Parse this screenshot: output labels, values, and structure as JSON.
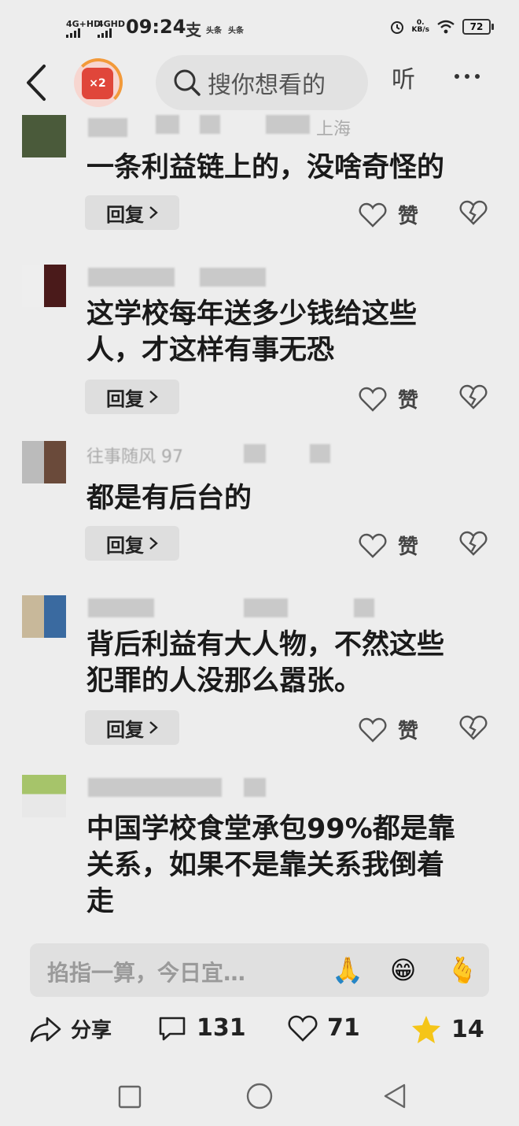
{
  "status_bar": {
    "net1": "4G+HD",
    "net2": "4GHD",
    "time": "09:24",
    "app_icons": [
      "支",
      "头条",
      "头条"
    ],
    "speed_top": "0.",
    "speed_unit": "KB/s",
    "battery": "72"
  },
  "header": {
    "badge_text": "×2",
    "search_placeholder": "搜你想看的",
    "partial_label": "听"
  },
  "comments": [
    {
      "username_partial": "上海",
      "text_lines": [
        "一条利益链上的，没啥奇怪的"
      ],
      "reply_label": "回复",
      "like_label": "赞"
    },
    {
      "username_partial": "",
      "text_lines": [
        "这学校每年送多少钱给这些",
        "人，才这样有事无恐"
      ],
      "reply_label": "回复",
      "like_label": "赞"
    },
    {
      "username_partial": "往事随风 97",
      "text_lines": [
        "都是有后台的"
      ],
      "reply_label": "回复",
      "like_label": "赞"
    },
    {
      "username_partial": "",
      "text_lines": [
        "背后利益有大人物，不然这些",
        "犯罪的人没那么嚣张。"
      ],
      "reply_label": "回复",
      "like_label": "赞"
    },
    {
      "username_partial": "",
      "text_lines": [
        "中国学校食堂承包99%都是靠",
        "关系，如果不是靠关系我倒着",
        "走"
      ],
      "reply_label": "",
      "like_label": ""
    }
  ],
  "input_bar": {
    "placeholder": "掐指一算，今日宜…",
    "emojis": [
      "🙏",
      "😁",
      "🫰"
    ]
  },
  "action_bar": {
    "share_label": "分享",
    "comment_count": "131",
    "like_count": "71",
    "fav_count": "14"
  },
  "colors": {
    "background": "#ededed",
    "accent_star": "#f5c518",
    "badge_red": "#e0463a"
  }
}
